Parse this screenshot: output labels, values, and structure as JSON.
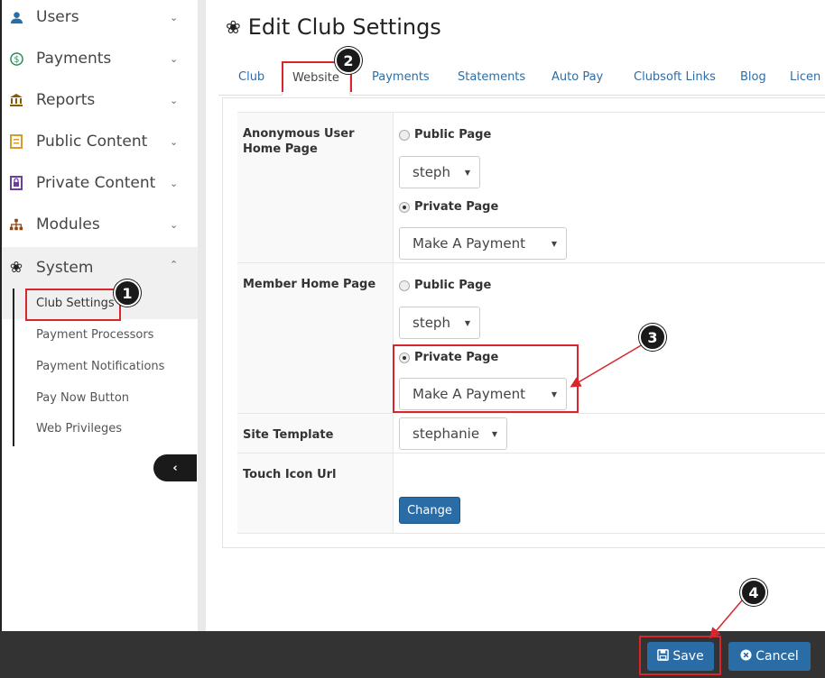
{
  "sidebar": {
    "items": [
      {
        "label": "Users",
        "icon": "user-icon",
        "color": "#2a6ca6"
      },
      {
        "label": "Payments",
        "icon": "dollar-circle-icon",
        "color": "#2e8b57"
      },
      {
        "label": "Reports",
        "icon": "bank-icon",
        "color": "#8b5a00"
      },
      {
        "label": "Public Content",
        "icon": "document-icon",
        "color": "#d89a2b"
      },
      {
        "label": "Private Content",
        "icon": "lock-document-icon",
        "color": "#6a3fa0"
      },
      {
        "label": "Modules",
        "icon": "sitemap-icon",
        "color": "#8b4513"
      },
      {
        "label": "System",
        "icon": "gear-icon",
        "color": "#222222"
      }
    ],
    "sub_items": [
      "Club Settings",
      "Payment Processors",
      "Payment Notifications",
      "Pay Now Button",
      "Web Privileges"
    ],
    "collapse_glyph": "‹"
  },
  "main": {
    "title": "Edit Club Settings",
    "tabs": [
      "Club",
      "Website",
      "Payments",
      "Statements",
      "Auto Pay",
      "Clubsoft Links",
      "Blog",
      "Licen"
    ],
    "active_tab": "Website",
    "rows": {
      "anon": {
        "label": "Anonymous User Home Page",
        "public_label": "Public Page",
        "public_value": "steph",
        "private_label": "Private Page",
        "private_value": "Make A Payment"
      },
      "member": {
        "label": "Member Home Page",
        "public_label": "Public Page",
        "public_value": "steph",
        "private_label": "Private Page",
        "private_value": "Make A Payment"
      },
      "template": {
        "label": "Site Template",
        "value": "stephanie"
      },
      "touch": {
        "label": "Touch Icon Url",
        "button": "Change"
      }
    }
  },
  "footer": {
    "save_label": "Save",
    "cancel_label": "Cancel"
  },
  "annotations": [
    "1",
    "2",
    "3",
    "4"
  ],
  "colors": {
    "accent": "#2a6ca6",
    "highlight": "#d9262c",
    "footer": "#333333"
  }
}
